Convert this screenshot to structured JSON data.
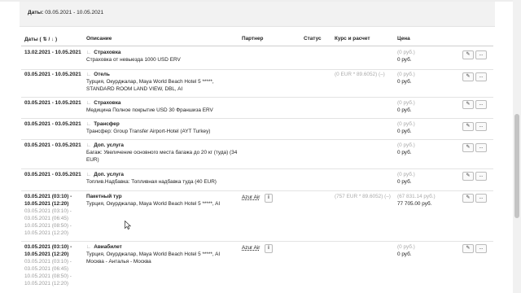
{
  "filter": {
    "label": "Даты:",
    "value": "03.05.2021 - 10.05.2021"
  },
  "table": {
    "headers": {
      "dates": "Даты ( ⇅ / ↓ )",
      "description": "Описание",
      "partner": "Партнер",
      "status": "Статус",
      "rate": "Курс и расчет",
      "price": "Цена"
    },
    "actions": {
      "edit": "✎",
      "more": "...",
      "info": "i"
    },
    "rows": [
      {
        "date": "13.02.2021 - 10.05.2021",
        "title": "Страховка",
        "desc": "Страховка от невыезда 1000 USD ERV",
        "rate": "",
        "price1": "(0 руб.)",
        "price2": "0 руб."
      },
      {
        "date": "03.05.2021 - 10.05.2021",
        "title": "Отель",
        "desc": "Турция, Окурджалар, Maya World Beach Hotel 5 *****, STANDARD ROOM LAND VIEW, DBL, AI",
        "rate": "(0 EUR * 89.6052) (–)",
        "price1": "(0 руб.)",
        "price2": "0 руб."
      },
      {
        "date": "03.05.2021 - 10.05.2021",
        "title": "Страховка",
        "desc": "Медицина Полное покрытие USD 30 Франшиза ERV",
        "rate": "",
        "price1": "(0 руб.)",
        "price2": "0 руб."
      },
      {
        "date": "03.05.2021 - 03.05.2021",
        "title": "Трансфер",
        "desc": "Трансфер: Group Transfer Airport-Hotel (AYT Turkey)",
        "rate": "",
        "price1": "(0 руб.)",
        "price2": "0 руб."
      },
      {
        "date": "03.05.2021 - 03.05.2021",
        "title": "Доп. услуга",
        "desc": "Багаж: Увеличение основного места багажа до 20 кг (туда) (34 EUR)",
        "rate": "",
        "price1": "(0 руб.)",
        "price2": "0 руб."
      },
      {
        "date": "03.05.2021 - 03.05.2021",
        "title": "Доп. услуга",
        "desc": "Топлив.Надбавка: Топливная надбавка туда (40 EUR)",
        "rate": "",
        "price1": "(0 руб.)",
        "price2": "0 руб."
      },
      {
        "date": "03.05.2021 (03:10) - 10.05.2021 (12:20)",
        "date_extra": [
          "03.05.2021 (03:10) -",
          "03.05.2021 (06:45)",
          "10.05.2021 (08:50) -",
          "10.05.2021 (12:20)"
        ],
        "title": "Пакетный тур",
        "desc": "Турция, Окурджалар, Maya World Beach Hotel 5 *****, AI",
        "partner": "Azur Air",
        "rate": "(757 EUR * 89.6052) (–)",
        "price1": "(67 831.14 руб.)",
        "price2": "77 705.00 руб."
      },
      {
        "date": "03.05.2021 (03:10) - 10.05.2021 (12:20)",
        "date_extra": [
          "03.05.2021 (03:10) -",
          "03.05.2021 (06:45)",
          "10.05.2021 (08:50) -",
          "10.05.2021 (12:20)"
        ],
        "title": "Авиабилет",
        "desc": "Турция, Окурджалар, Maya World Beach Hotel 5 *****, AI",
        "desc2": "Москва - Анталья - Москва",
        "partner": "Azur Air",
        "rate": "",
        "price1": "(0 руб.)",
        "price2": "0 руб."
      }
    ]
  }
}
